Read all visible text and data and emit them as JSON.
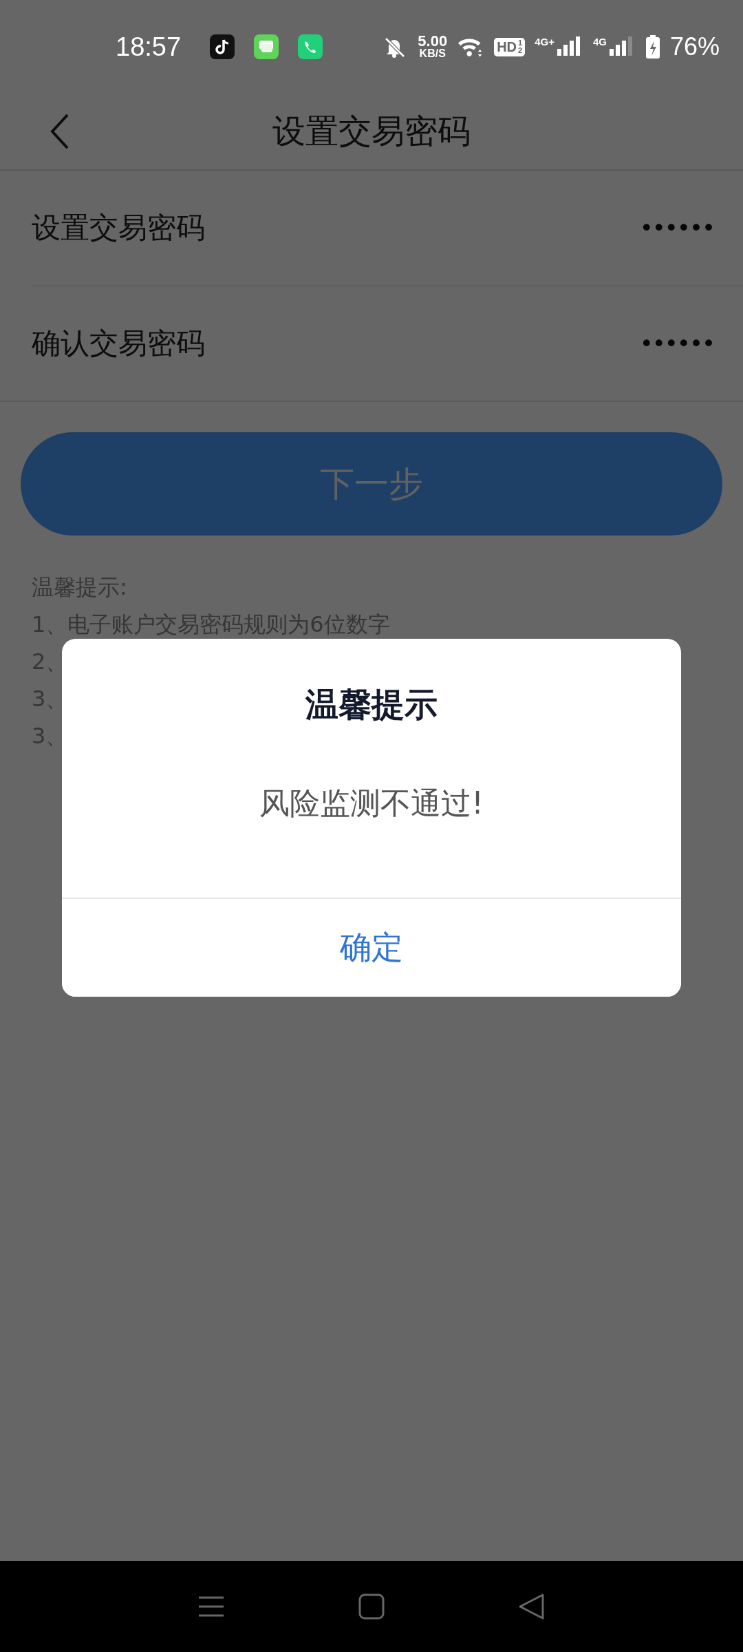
{
  "status_bar": {
    "time": "18:57",
    "speed_value": "5.00",
    "speed_unit": "KB/S",
    "hd": "HD",
    "hd_sims": [
      "1",
      "2"
    ],
    "networks": [
      {
        "label": "4G+",
        "kind": "full"
      },
      {
        "label": "4G",
        "kind": "partial"
      }
    ],
    "battery": "76%"
  },
  "nav": {
    "title": "设置交易密码"
  },
  "fields": [
    {
      "label": "设置交易密码",
      "value": "••••••"
    },
    {
      "label": "确认交易密码",
      "value": "••••••"
    }
  ],
  "next_button": {
    "label": "下一步",
    "disabled": true
  },
  "tips": {
    "title": "温馨提示:",
    "items": [
      "1、电子账户交易密码规则为6位数字",
      "2、",
      "3、",
      "3、"
    ]
  },
  "dialog": {
    "title": "温馨提示",
    "message": "风险监测不通过!",
    "confirm": "确定"
  }
}
